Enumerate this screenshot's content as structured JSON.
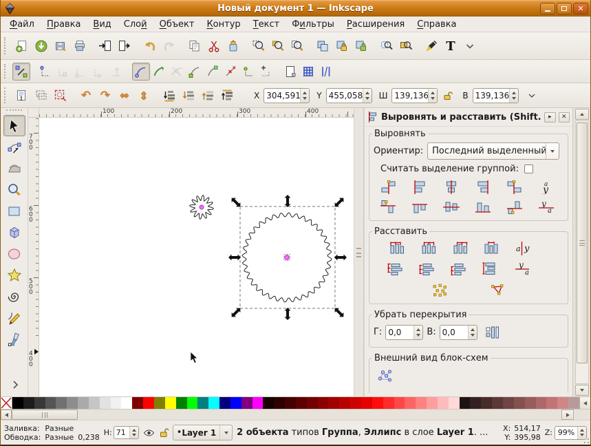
{
  "window": {
    "title": "Новый документ 1 — Inkscape"
  },
  "theme": {
    "titlebar_orange": "#cd7b16",
    "toolbar_bg": "#efebe7",
    "grid_blue": "#3a55c8",
    "selection_pink": "#ee6ef0",
    "align_red": "#c00000",
    "align_bar_blue": "#c3d6ea"
  },
  "menu": {
    "items": [
      {
        "label": "Файл",
        "u": 0
      },
      {
        "label": "Правка",
        "u": 0
      },
      {
        "label": "Вид",
        "u": 0
      },
      {
        "label": "Слой",
        "u": 3
      },
      {
        "label": "Объект",
        "u": 0
      },
      {
        "label": "Контур",
        "u": 0
      },
      {
        "label": "Текст",
        "u": 0
      },
      {
        "label": "Фильтры",
        "u": 1
      },
      {
        "label": "Расширения",
        "u": 0
      },
      {
        "label": "Справка",
        "u": 0
      }
    ]
  },
  "toolbars": {
    "commands": [
      {
        "name": "new-document"
      },
      {
        "name": "open-document"
      },
      {
        "name": "save-document"
      },
      {
        "name": "print-document"
      },
      {
        "sep": true
      },
      {
        "name": "import"
      },
      {
        "name": "export"
      },
      {
        "sep": true
      },
      {
        "name": "undo"
      },
      {
        "name": "redo",
        "disabled": true
      },
      {
        "sep": true
      },
      {
        "name": "copy"
      },
      {
        "name": "cut"
      },
      {
        "name": "paste"
      },
      {
        "sep": true
      },
      {
        "name": "zoom-selection"
      },
      {
        "name": "zoom-drawing"
      },
      {
        "name": "zoom-page"
      },
      {
        "sep": true
      },
      {
        "name": "duplicate"
      },
      {
        "name": "clone"
      },
      {
        "name": "unlink-clone"
      },
      {
        "sep": true
      },
      {
        "name": "find"
      },
      {
        "name": "xml-editor"
      },
      {
        "sep": true
      },
      {
        "name": "fill-stroke-dialog"
      },
      {
        "name": "text-dialog"
      },
      {
        "name": "toolbar-overflow"
      }
    ],
    "snap": [
      {
        "name": "snap-enable",
        "active": true
      },
      {
        "sep": true
      },
      {
        "name": "snap-bbox"
      },
      {
        "name": "snap-bbox-edges",
        "disabled": true
      },
      {
        "name": "snap-bbox-corners",
        "disabled": true
      },
      {
        "name": "snap-bbox-edge-midpoints",
        "disabled": true
      },
      {
        "name": "snap-bbox-centers",
        "disabled": true
      },
      {
        "sep": true
      },
      {
        "name": "snap-nodes",
        "active": true
      },
      {
        "name": "snap-paths"
      },
      {
        "name": "snap-path-intersections",
        "disabled": true
      },
      {
        "name": "snap-cusp-nodes"
      },
      {
        "name": "snap-smooth-nodes"
      },
      {
        "name": "snap-midpoints"
      },
      {
        "name": "snap-object-centers"
      },
      {
        "name": "snap-rotation-centers"
      },
      {
        "sep": true
      },
      {
        "name": "snap-page-border"
      },
      {
        "name": "snap-grid"
      },
      {
        "name": "snap-guides"
      }
    ],
    "tool_options": {
      "buttons": [
        {
          "name": "select-all"
        },
        {
          "name": "select-all-layers"
        },
        {
          "name": "deselect"
        },
        {
          "sep": true
        },
        {
          "name": "rotate-ccw"
        },
        {
          "name": "rotate-cw"
        },
        {
          "name": "flip-horizontal"
        },
        {
          "name": "flip-vertical"
        },
        {
          "sep": true
        },
        {
          "name": "lower-to-bottom"
        },
        {
          "name": "lower"
        },
        {
          "name": "raise"
        },
        {
          "name": "raise-to-top"
        },
        {
          "sep": true
        }
      ],
      "fields": [
        {
          "label": "X",
          "value": "304,591"
        },
        {
          "label": "Y",
          "value": "455,058"
        },
        {
          "label": "Ш",
          "value": "139,136"
        },
        {
          "label": "В",
          "value": "139,136"
        }
      ]
    }
  },
  "toolbox": [
    {
      "name": "selector",
      "active": true
    },
    {
      "name": "node-editor"
    },
    {
      "name": "tweak"
    },
    {
      "name": "zoom"
    },
    {
      "name": "rectangle"
    },
    {
      "name": "box-3d"
    },
    {
      "name": "ellipse"
    },
    {
      "name": "star"
    },
    {
      "name": "spiral"
    },
    {
      "name": "pencil"
    },
    {
      "name": "calligraphy"
    }
  ],
  "rulers": {
    "horizontal": [
      "100",
      "200",
      "300",
      "400"
    ],
    "vertical": [
      "700",
      "600",
      "500",
      "400"
    ]
  },
  "canvas": {
    "objects": [
      {
        "type": "gear-outline",
        "center_dot": true
      },
      {
        "type": "wavy-circle",
        "selected": true,
        "center_dot": true
      }
    ]
  },
  "panel": {
    "title": "Выровнять и расставить (Shift...",
    "align": {
      "legend": "Выровнять",
      "anchor_label": "Ориентир:",
      "anchor_value": "Последний выделенный",
      "group_label": "Считать выделение группой:",
      "group_checked": false,
      "rows": [
        [
          "align-right-to-anchor-left",
          "align-left-edges",
          "align-center-horizontal",
          "align-right-edges",
          "align-left-to-anchor-right",
          "align-text-horizontal"
        ],
        [
          "align-bottom-to-anchor-top",
          "align-top-edges",
          "align-center-vertical",
          "align-bottom-edges",
          "align-top-to-anchor-bottom",
          "align-text-vertical"
        ]
      ]
    },
    "distribute": {
      "legend": "Расставить",
      "rows": [
        [
          "distribute-left-edges",
          "distribute-centers-horizontal",
          "distribute-right-edges",
          "distribute-gaps-horizontal",
          "distribute-text-horizontal"
        ],
        [
          "distribute-top-edges",
          "distribute-centers-vertical",
          "distribute-bottom-edges",
          "distribute-gaps-vertical",
          "distribute-text-vertical"
        ],
        [
          "randomize-positions",
          "unclump"
        ]
      ]
    },
    "overlap": {
      "legend": "Убрать перекрытия",
      "h_label": "Г:",
      "h_value": "0,0",
      "v_label": "В:",
      "v_value": "0,0"
    },
    "connector": {
      "legend": "Внешний вид блок-схем"
    }
  },
  "palette": {
    "colors": [
      "none",
      "#000000",
      "#1c1c1c",
      "#383838",
      "#555555",
      "#717171",
      "#8d8d8d",
      "#aaaaaa",
      "#c6c6c6",
      "#e2e2e2",
      "#f1f1f1",
      "#ffffff",
      "#800000",
      "#ff0000",
      "#808000",
      "#ffff00",
      "#008000",
      "#00ff00",
      "#008080",
      "#00ffff",
      "#000080",
      "#0000ff",
      "#800080",
      "#ff00ff",
      "#170000",
      "#2e0000",
      "#450000",
      "#5c0000",
      "#730000",
      "#8a0000",
      "#a10000",
      "#b80000",
      "#cf0000",
      "#e60000",
      "#ff0d0d",
      "#ff2a2a",
      "#ff4747",
      "#ff6464",
      "#ff8181",
      "#ff9e9e",
      "#ffbbbb",
      "#ffd8d8",
      "#1f1414",
      "#332020",
      "#472c2c",
      "#5c3838",
      "#704444",
      "#855050",
      "#995c5c",
      "#ad6868",
      "#c27474",
      "#d18585",
      "#b99a9a"
    ]
  },
  "statusbar": {
    "fill_label": "Заливка:",
    "fill_value": "Разные",
    "stroke_label": "Обводка:",
    "stroke_value": "Разные",
    "stroke_width": "0,238",
    "opacity_label": "Н:",
    "opacity_value": "71",
    "layer_prefix": "•",
    "layer_name": "Layer 1",
    "message": [
      {
        "text": "2 объекта",
        "bold": true
      },
      {
        "text": " типов ",
        "bold": false
      },
      {
        "text": "Группа",
        "bold": true
      },
      {
        "text": ", ",
        "bold": false
      },
      {
        "text": "Эллипс",
        "bold": true
      },
      {
        "text": " в слое ",
        "bold": false
      },
      {
        "text": "Layer 1",
        "bold": true
      },
      {
        "text": ". ...",
        "bold": false
      }
    ],
    "x_label": "X:",
    "x_value": "514,17",
    "y_label": "Y:",
    "y_value": "395,98",
    "z_label": "Z:",
    "z_value": "99%"
  }
}
